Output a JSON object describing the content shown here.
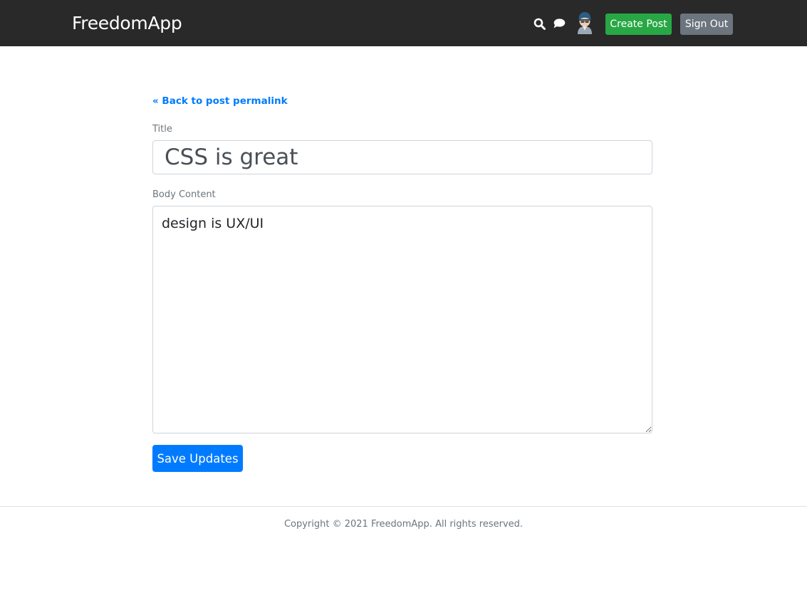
{
  "header": {
    "brand": "FreedomApp",
    "icons": {
      "search": "search-icon",
      "chat": "chat-icon"
    },
    "avatar": "avatar",
    "create_post_label": "Create Post",
    "sign_out_label": "Sign Out"
  },
  "main": {
    "back_link": "« Back to post permalink",
    "title_label": "Title",
    "title_value": "CSS is great",
    "body_label": "Body Content",
    "body_value": "design is UX/UI",
    "save_label": "Save Updates"
  },
  "footer": {
    "copyright": "Copyright © 2021 FreedomApp. All rights reserved."
  },
  "colors": {
    "navbar": "#292929",
    "primary": "#007bff",
    "success": "#28a745",
    "secondary": "#6c757d"
  }
}
